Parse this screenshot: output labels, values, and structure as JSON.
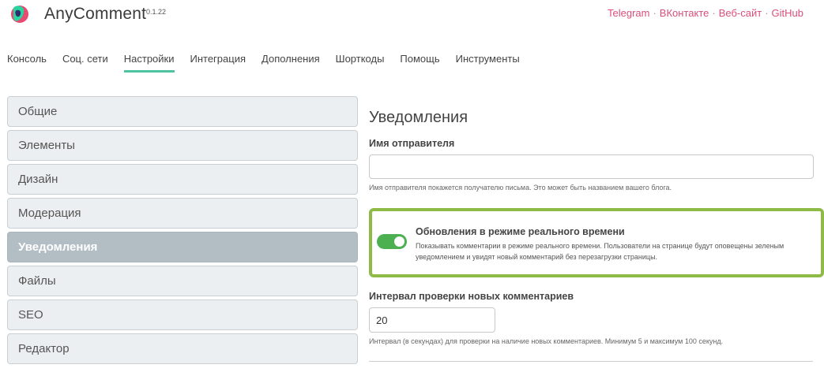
{
  "header": {
    "app_name": "AnyComment",
    "version": "0.1.22",
    "links": [
      "Telegram",
      "ВКонтакте",
      "Веб-сайт",
      "GitHub"
    ],
    "link_separator": "·"
  },
  "tabs": [
    "Консоль",
    "Соц. сети",
    "Настройки",
    "Интеграция",
    "Дополнения",
    "Шорткоды",
    "Помощь",
    "Инструменты"
  ],
  "active_tab": "Настройки",
  "sidebar": {
    "items": [
      "Общие",
      "Элементы",
      "Дизайн",
      "Модерация",
      "Уведомления",
      "Файлы",
      "SEO",
      "Редактор"
    ],
    "active": "Уведомления"
  },
  "main": {
    "title": "Уведомления",
    "sender_name": {
      "label": "Имя отправителя",
      "value": "",
      "hint": "Имя отправителя покажется получателю письма. Это может быть названием вашего блога."
    },
    "realtime": {
      "title": "Обновления в режиме реального времени",
      "enabled": true,
      "description": "Показывать комментарии в режиме реального времени. Пользователи на странице будут оповещены зеленым уведомлением и увидят новый комментарий без перезагрузки страницы."
    },
    "interval": {
      "label": "Интервал проверки новых комментариев",
      "value": "20",
      "hint": "Интервал (в секундах) для проверки на наличие новых комментариев. Минимум 5 и максимум 100 секунд."
    }
  },
  "colors": {
    "accent": "#4fc3a1",
    "link": "#d94f7a",
    "toggle_on": "#4caf50",
    "highlight_border": "#8dbb46",
    "sidebar_active": "#b3bec4"
  }
}
